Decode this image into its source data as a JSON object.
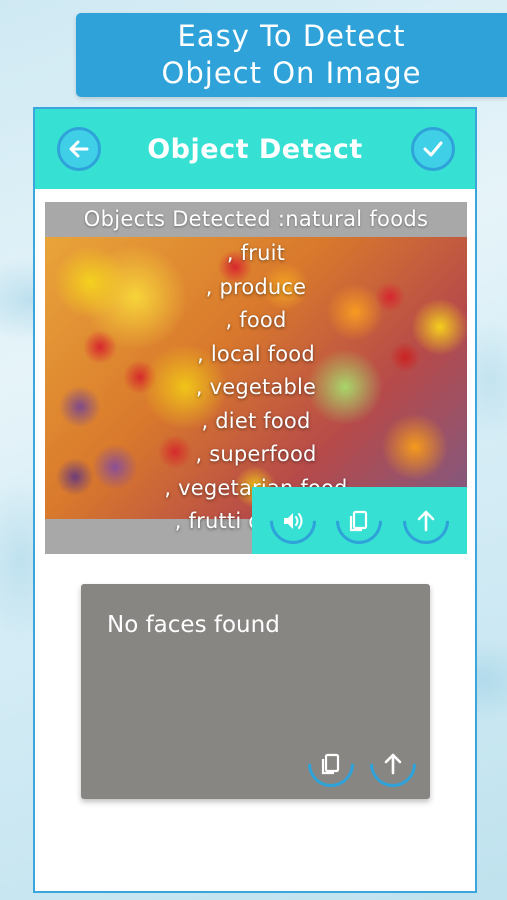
{
  "promo": {
    "line1": "Easy To Detect",
    "line2": "Object On Image"
  },
  "header": {
    "title": "Object Detect",
    "back_icon": "back-arrow-icon",
    "done_icon": "check-icon"
  },
  "result": {
    "heading": "Objects Detected :natural foods",
    "items": [
      ", fruit",
      ", produce",
      ", food",
      ", local food",
      ", vegetable",
      ", diet food",
      ", superfood",
      ", vegetarian food",
      ", frutti di bosco"
    ],
    "actions": [
      "speaker-icon",
      "copy-icon",
      "share-icon"
    ]
  },
  "faces": {
    "message": "No faces found",
    "actions": [
      "copy-icon",
      "share-icon"
    ]
  },
  "colors": {
    "accent": "#36e0d2",
    "banner": "#2fa3d9",
    "card": "#878683"
  }
}
